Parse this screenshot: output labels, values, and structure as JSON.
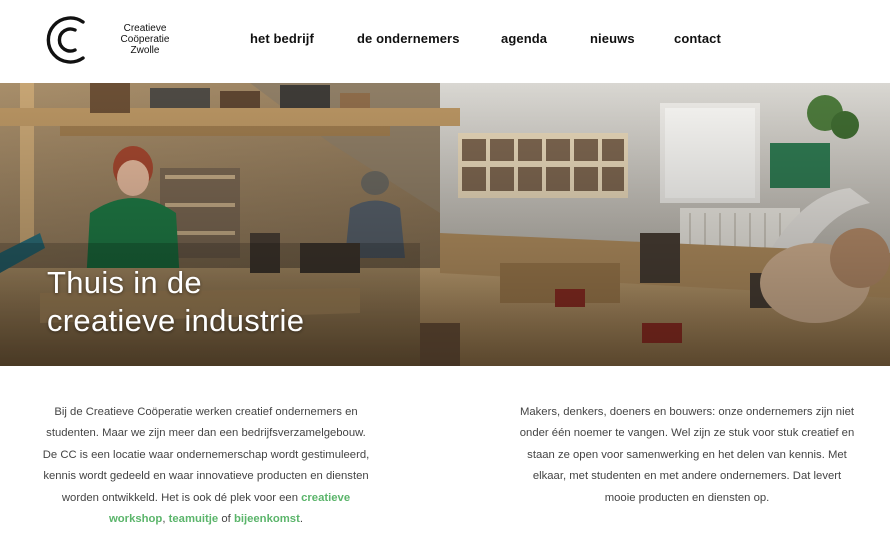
{
  "header": {
    "logo": {
      "line1": "Creatieve",
      "line2": "Coöperatie",
      "line3": "Zwolle"
    },
    "nav": [
      {
        "label": "het bedrijf"
      },
      {
        "label": "de ondernemers"
      },
      {
        "label": "agenda"
      },
      {
        "label": "nieuws"
      },
      {
        "label": "contact"
      }
    ]
  },
  "hero": {
    "title_line1": "Thuis in de",
    "title_line2": "creatieve industrie"
  },
  "content": {
    "left": {
      "text_before": "Bij de Creatieve Coöperatie werken creatief ondernemers en studenten. Maar we zijn meer dan een bedrijfsverzamelgebouw. De CC is een locatie waar ondernemerschap wordt gestimuleerd, kennis wordt gedeeld en waar innovatieve producten en diensten worden ontwikkeld. Het is ook dé plek voor een ",
      "link1": "creatieve workshop",
      "sep1": ", ",
      "link2": "teamuitje",
      "sep2": " of ",
      "link3": "bijeenkomst",
      "text_after": "."
    },
    "right": {
      "text": "Makers, denkers, doeners en bouwers: onze ondernemers zijn niet onder één noemer te vangen. Wel zijn ze stuk voor stuk creatief en staan ze open voor samenwerking en het delen van kennis. Met elkaar, met studenten en met andere ondernemers. Dat levert mooie producten en diensten op."
    }
  },
  "colors": {
    "link": "#5bb56b",
    "text": "#444444",
    "nav": "#111111"
  }
}
